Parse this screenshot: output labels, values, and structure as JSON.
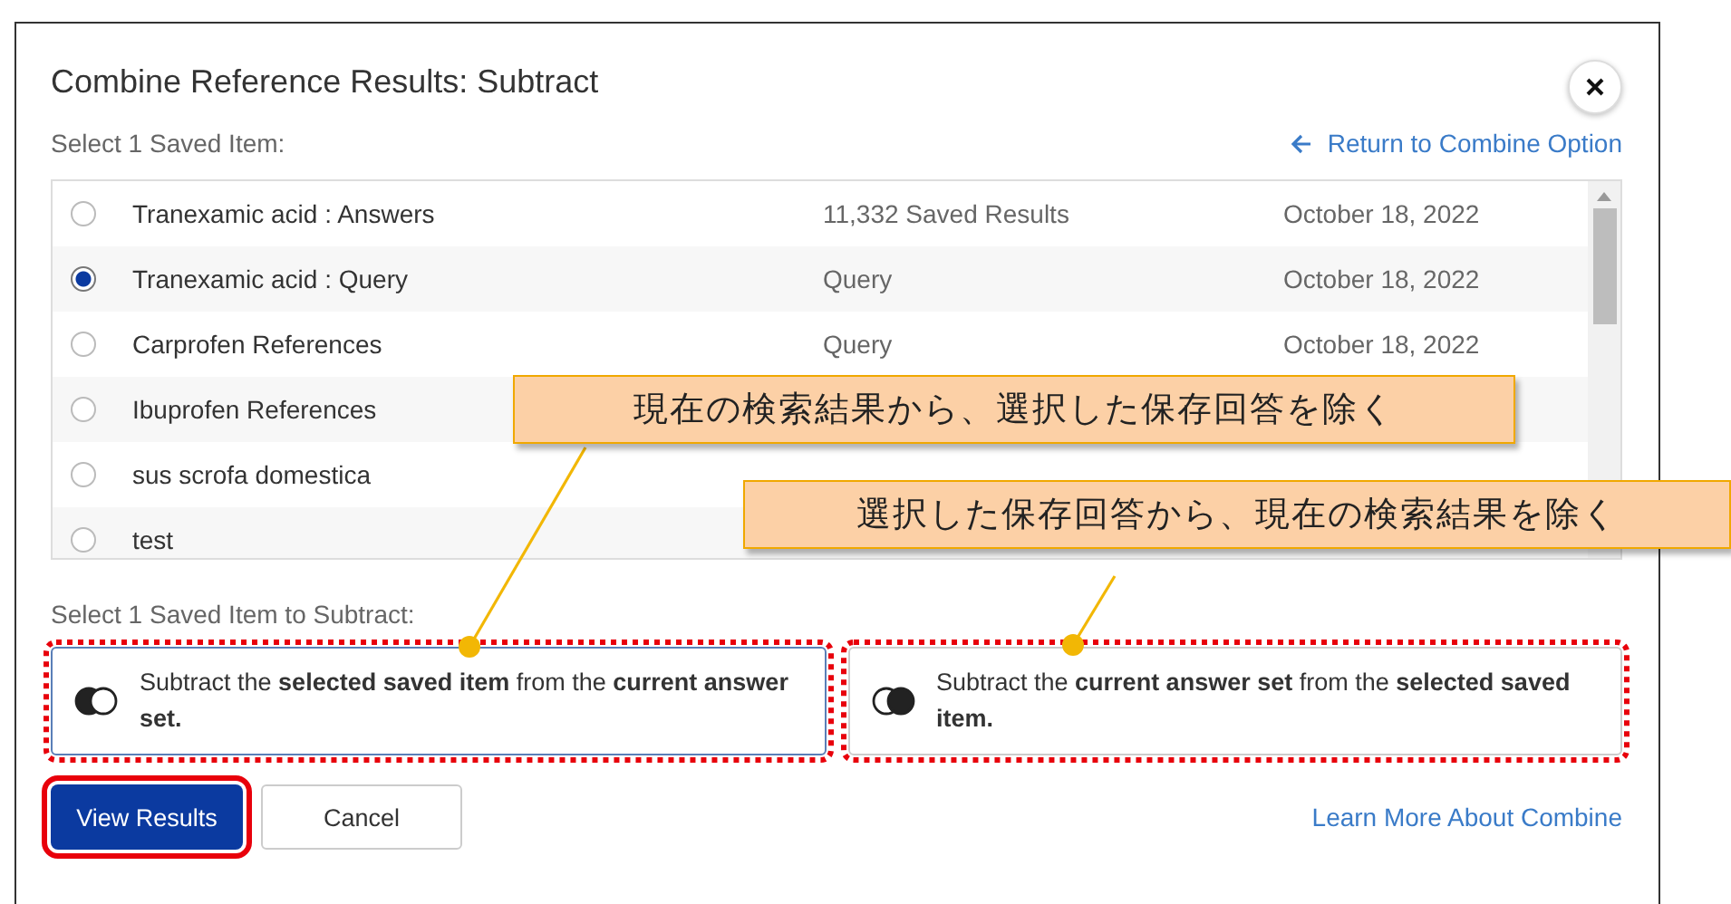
{
  "dialog": {
    "title": "Combine Reference Results: Subtract",
    "saved_label": "Select 1 Saved Item:",
    "return_link": "Return to Combine Option",
    "items": [
      {
        "name": "Tranexamic acid : Answers",
        "type": "11,332 Saved Results",
        "date": "October 18, 2022",
        "selected": false
      },
      {
        "name": "Tranexamic acid : Query",
        "type": "Query",
        "date": "October 18, 2022",
        "selected": true
      },
      {
        "name": "Carprofen References",
        "type": "Query",
        "date": "October 18, 2022",
        "selected": false
      },
      {
        "name": "Ibuprofen References",
        "selected": false
      },
      {
        "name": "sus scrofa domestica",
        "selected": false
      },
      {
        "name": "test",
        "selected": false
      }
    ],
    "subtract_label": "Select 1 Saved Item to Subtract:",
    "options": [
      {
        "kind": "left",
        "text": "Subtract the **selected saved item** from the **current answer set.**",
        "selected": true,
        "highlighted": true
      },
      {
        "kind": "right",
        "text": "Subtract the **current answer set** from the **selected saved item.**",
        "selected": false,
        "highlighted": true
      }
    ],
    "buttons": [
      {
        "label": "View Results",
        "kind": "primary",
        "highlighted": true
      },
      {
        "label": "Cancel",
        "kind": "secondary",
        "highlighted": false
      }
    ],
    "learn_link": "Learn More About Combine"
  },
  "callouts": [
    {
      "text": "現在の検索結果から、選択した保存回答を除く"
    },
    {
      "text": "選択した保存回答から、現在の検索結果を除く"
    }
  ]
}
